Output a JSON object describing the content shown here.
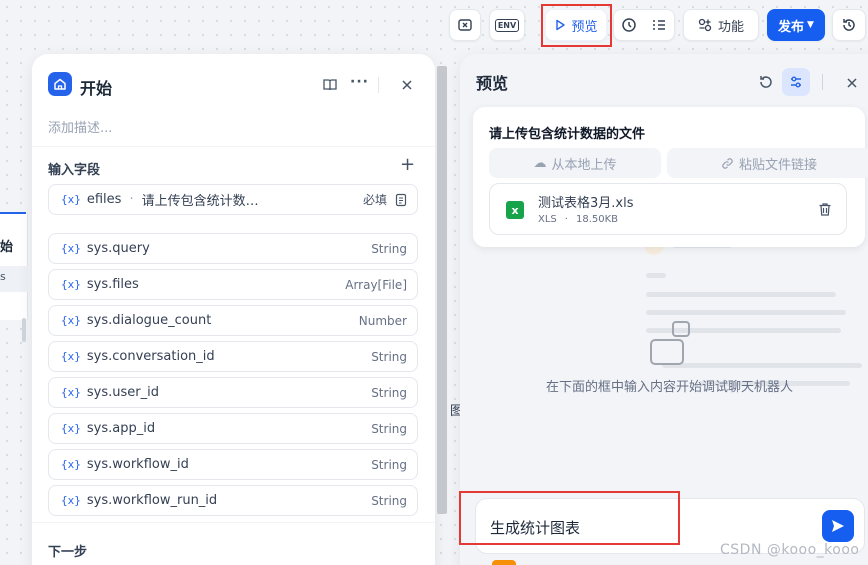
{
  "toolbar": {
    "preview_label": "预览",
    "features_label": "功能",
    "publish_label": "发布",
    "env_label": "ENV"
  },
  "start_panel": {
    "title": "开始",
    "description_placeholder": "添加描述...",
    "input_fields_heading": "输入字段",
    "input_var": {
      "icon": "{x}",
      "name": "efiles",
      "separator": "·",
      "label": "请上传包含统计数…",
      "required": "必填"
    },
    "sys_vars": [
      {
        "icon": "{x}",
        "name": "sys.query",
        "type": "String"
      },
      {
        "icon": "{x}",
        "name": "sys.files",
        "type": "Array[File]"
      },
      {
        "icon": "{x}",
        "name": "sys.dialogue_count",
        "type": "Number"
      },
      {
        "icon": "{x}",
        "name": "sys.conversation_id",
        "type": "String"
      },
      {
        "icon": "{x}",
        "name": "sys.user_id",
        "type": "String"
      },
      {
        "icon": "{x}",
        "name": "sys.app_id",
        "type": "String"
      },
      {
        "icon": "{x}",
        "name": "sys.workflow_id",
        "type": "String"
      },
      {
        "icon": "{x}",
        "name": "sys.workflow_run_id",
        "type": "String"
      }
    ],
    "next_step_heading": "下一步"
  },
  "preview_panel": {
    "title": "预览",
    "upload_title": "请上传包含统计数据的文件",
    "local_upload_label": "从本地上传",
    "paste_link_label": "粘贴文件链接",
    "file": {
      "name": "测试表格3月.xls",
      "ext": "XLS",
      "dot": "·",
      "size": "18.50KB",
      "badge": "x"
    },
    "empty_hint": "在下面的框中输入内容开始调试聊天机器人",
    "chat_input_value": "生成统计图表"
  },
  "left_edge": {
    "char1": "始",
    "char2": "s"
  },
  "canvas_fragment": "图",
  "watermark": "CSDN @kooo_kooo",
  "colors": {
    "accent": "#2563eb",
    "highlight": "#e53935",
    "excel": "#16a34a"
  }
}
